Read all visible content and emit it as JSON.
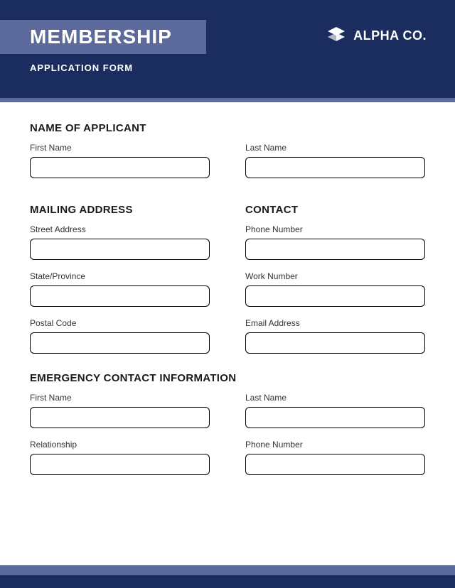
{
  "header": {
    "title": "MEMBERSHIP",
    "subtitle": "APPLICATION FORM",
    "company": "ALPHA CO."
  },
  "sections": {
    "applicant": {
      "title": "NAME OF APPLICANT",
      "first_name_label": "First Name",
      "last_name_label": "Last Name"
    },
    "mailing": {
      "title": "MAILING ADDRESS",
      "street_label": "Street Address",
      "state_label": "State/Province",
      "postal_label": "Postal Code"
    },
    "contact": {
      "title": "CONTACT",
      "phone_label": "Phone Number",
      "work_label": "Work Number",
      "email_label": "Email Address"
    },
    "emergency": {
      "title": "EMERGENCY CONTACT INFORMATION",
      "first_name_label": "First Name",
      "last_name_label": "Last Name",
      "relationship_label": "Relationship",
      "phone_label": "Phone Number"
    }
  }
}
